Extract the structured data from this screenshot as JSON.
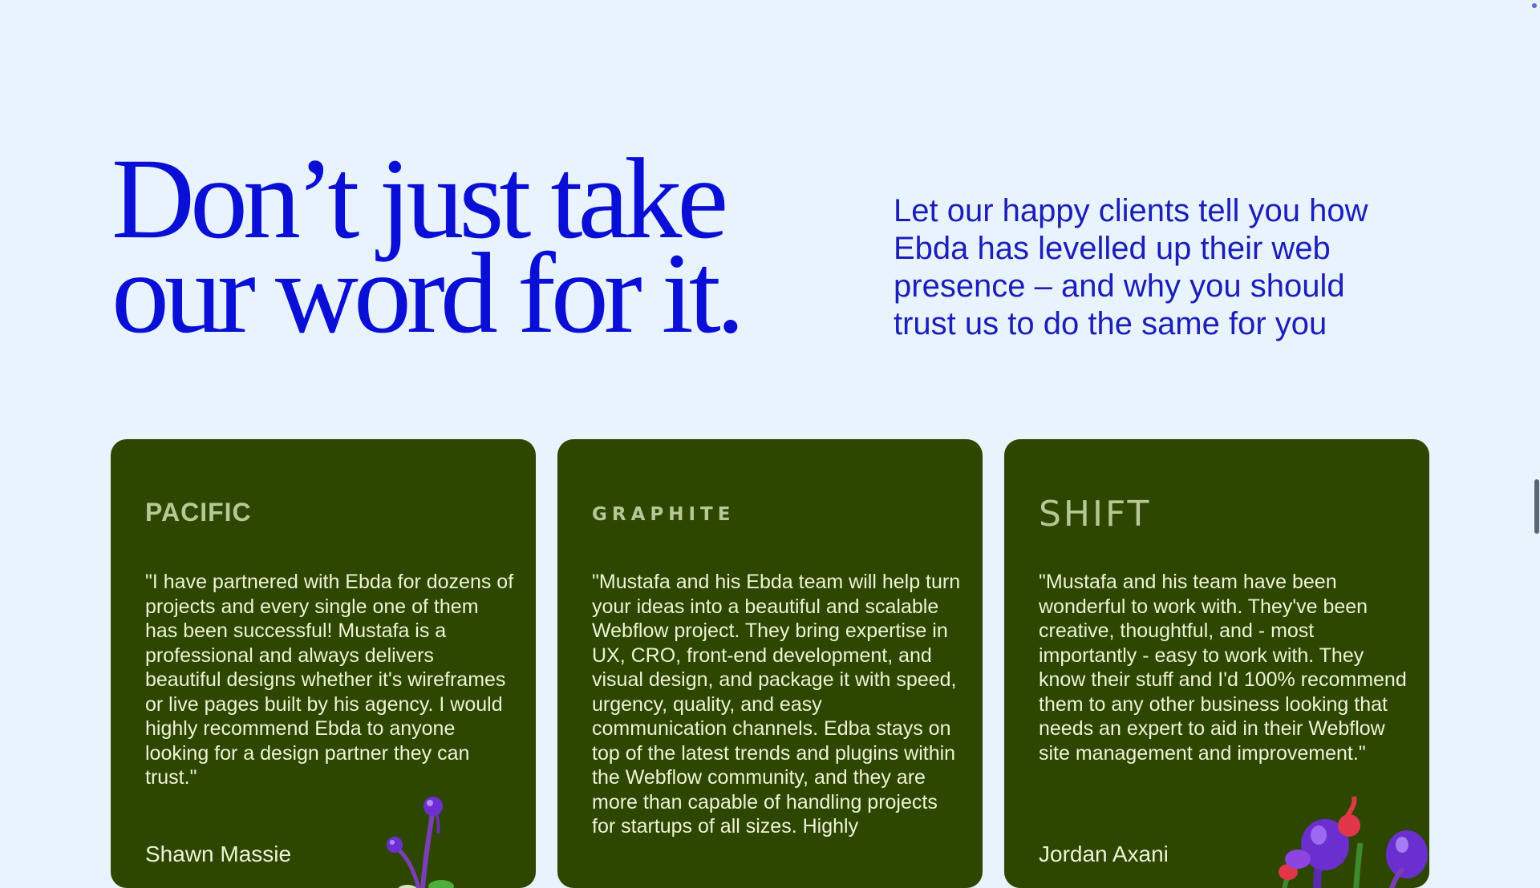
{
  "header": {
    "headline_line1": "Don’t just take",
    "headline_line2": "our word for it.",
    "intro": "Let our happy clients tell you how Ebda has levelled up their web presence – and why you should trust us to do the same for you"
  },
  "testimonials": [
    {
      "logo": "PACIFIC",
      "quote": "\"I have partnered with Ebda for dozens of projects and every single one of them has been successful! Mustafa is a professional and always delivers beautiful designs whether it's wireframes or live pages built by his agency. I would highly recommend Ebda to anyone looking for a design partner they can trust.\"",
      "author": "Shawn Massie"
    },
    {
      "logo": "GRAPHITE",
      "quote": "\"Mustafa and his Ebda team will help turn your ideas into a beautiful and scalable Webflow project. They bring expertise in UX, CRO, front-end development, and visual design, and package it with speed, urgency, quality, and easy communication channels. Edba stays on top of the latest trends and plugins within the Webflow community, and they are more than capable of handling projects for startups of all sizes. Highly"
    },
    {
      "logo": "SHIFT",
      "quote": "\"Mustafa and his team have been wonderful to work with. They've been creative, thoughtful, and - most importantly - easy to work with. They know their stuff and I'd 100% recommend them to any other business looking that needs an expert to aid in their Webflow site management and improvement.\"",
      "author": "Jordan Axani"
    }
  ],
  "colors": {
    "background": "#E9F3FD",
    "headline": "#0A0FD6",
    "card": "#2D4700",
    "card_text": "#EEF2D6",
    "logo": "#B7C796"
  },
  "icons": {
    "card1_decoration": "purple-flower-sprout-icon",
    "card3_decoration": "purple-mushroom-cluster-icon"
  }
}
